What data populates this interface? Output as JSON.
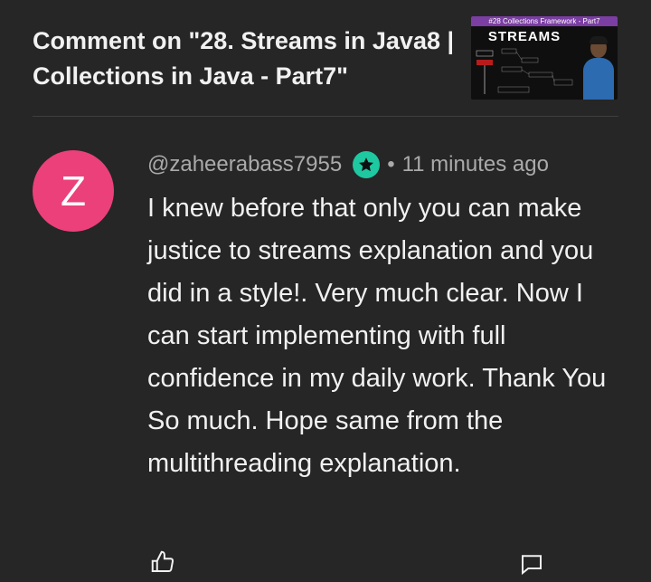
{
  "header": {
    "title": "Comment on \"28. Streams in Java8 | Collections in Java - Part7\""
  },
  "thumbnail": {
    "banner": "#28 Collections Framework - Part7",
    "heading": "STREAMS"
  },
  "comment": {
    "avatar_letter": "Z",
    "author": "@zaheerabass7955",
    "separator": "•",
    "time": "11 minutes ago",
    "text": "I knew before that only you can make justice to streams explanation and you did in a style!. Very much clear. Now I can start implementing with full confidence in my daily work. Thank You So much. Hope same from the multithreading explanation."
  },
  "colors": {
    "background": "#262626",
    "avatar": "#ec407a",
    "badge": "#1ec8a0",
    "meta_text": "#aaaaaa"
  },
  "icons": {
    "badge": "star-icon",
    "like": "thumbs-up-icon",
    "replies": "comment-icon"
  }
}
